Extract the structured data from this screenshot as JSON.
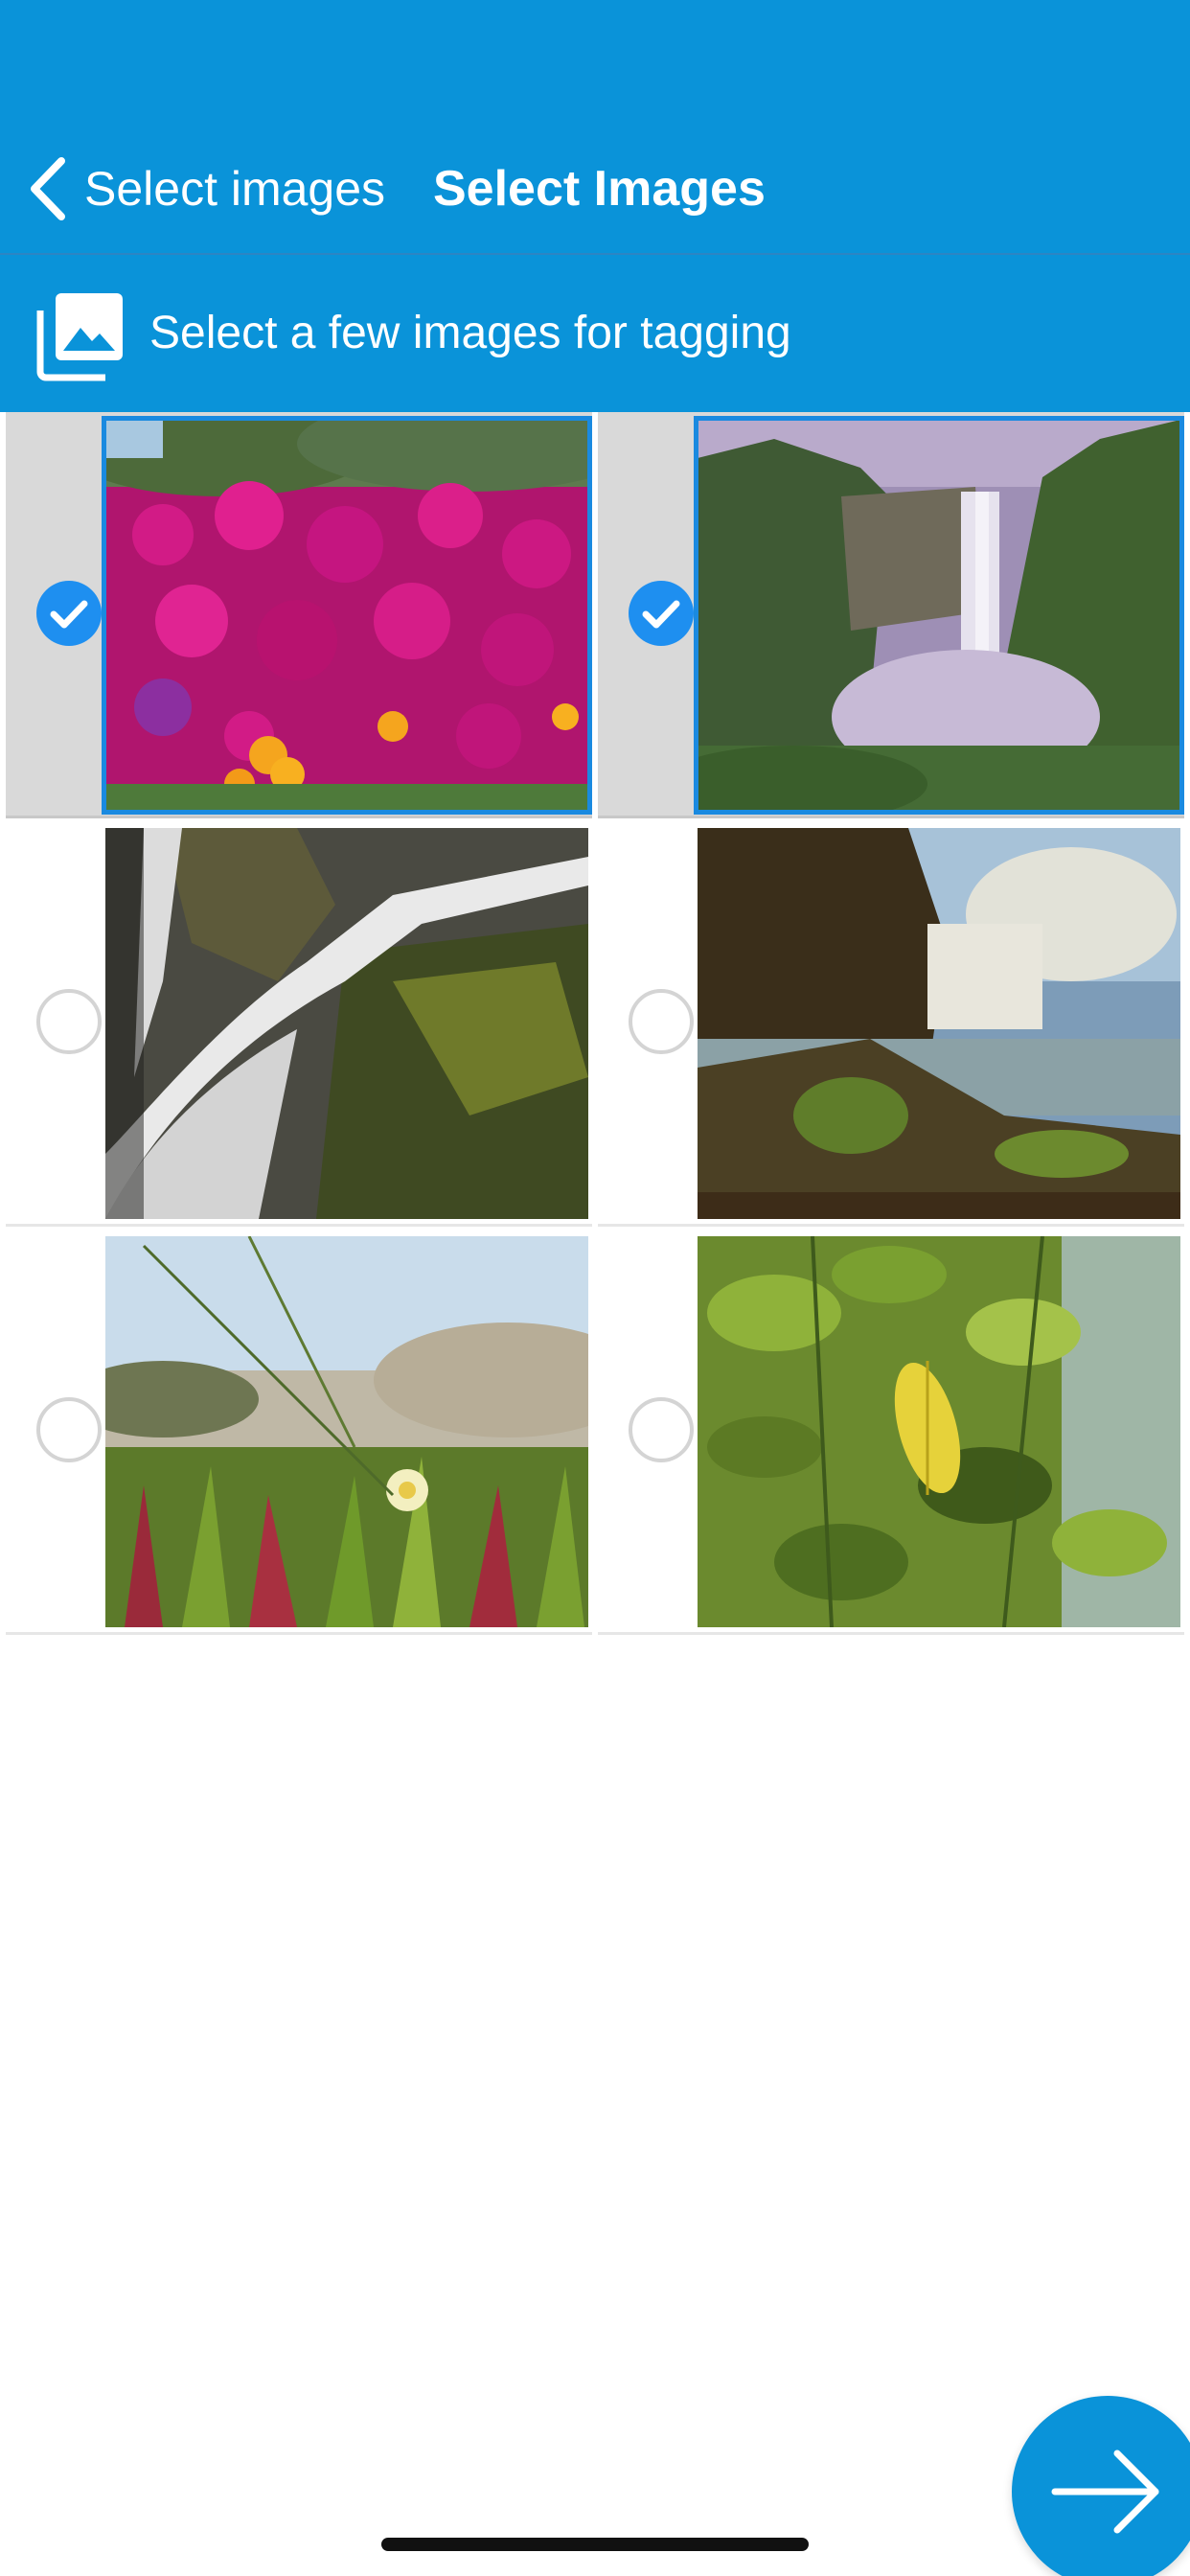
{
  "nav": {
    "back_label": "Select images",
    "title": "Select Images"
  },
  "subheader": {
    "icon": "photo-library-icon",
    "text": "Select a few images for tagging"
  },
  "images": [
    {
      "subject": "pink flowers field",
      "selected": true
    },
    {
      "subject": "waterfall in green canyon",
      "selected": true
    },
    {
      "subject": "waterfall over mossy rocks",
      "selected": false
    },
    {
      "subject": "waterfall with cliff and plants",
      "selected": false
    },
    {
      "subject": "ice plant with white flower on dunes",
      "selected": false
    },
    {
      "subject": "green leaves with yellow leaf",
      "selected": false
    }
  ],
  "next_button": {
    "icon": "arrow-right-icon"
  },
  "colors": {
    "accent": "#0a93d9",
    "checkbox": "#1e8ff0",
    "selected_cell": "#d9d9d9",
    "selected_border": "#1a8ae0"
  }
}
